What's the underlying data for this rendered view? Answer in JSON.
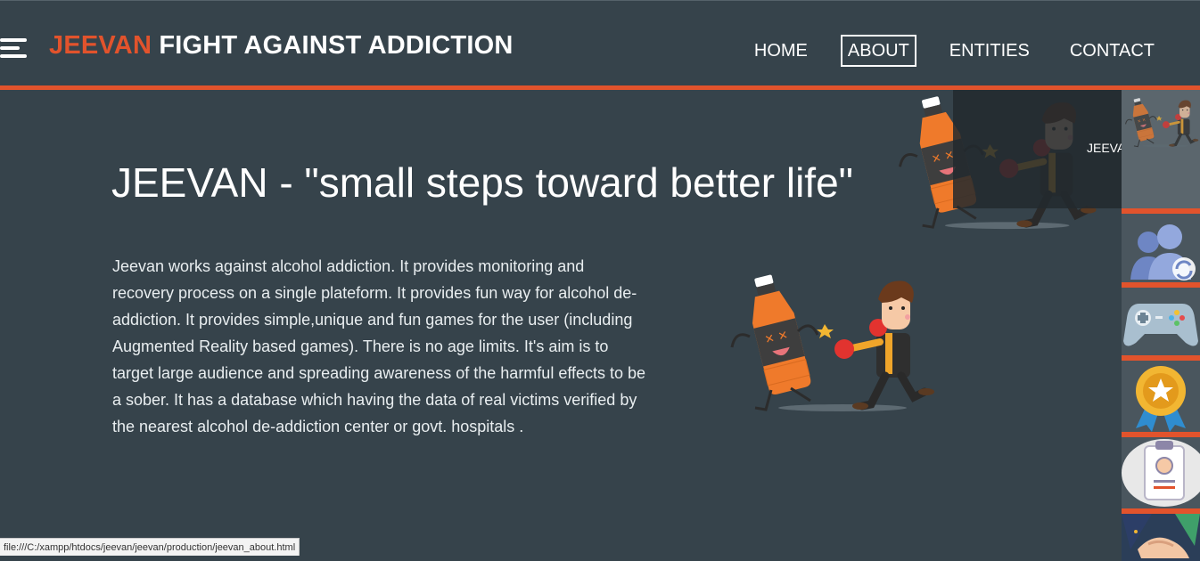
{
  "header": {
    "brand_accent": "JEEVAN",
    "brand_rest": " FIGHT AGAINST ADDICTION",
    "menu_icon": "hamburger-icon"
  },
  "nav": {
    "home": "HOME",
    "about": "ABOUT",
    "entities": "ENTITIES",
    "contact": "CONTACT",
    "active": "ABOUT"
  },
  "hero": {
    "title": "JEEVAN - \"small steps toward better life\"",
    "description": "Jeevan works against alcohol addiction. It provides monitoring and recovery process on a single plateform. It provides fun way for alcohol de-addiction. It provides simple,unique and fun games for the user (including Augmented Reality based games). There is no age limits. It's aim is to target large audience and spreading awareness of the harmful effects to be a sober. It has a database which having the data of real victims verified by the nearest alcohol de-addiction center or govt. hospitals ."
  },
  "sidebar": {
    "tooltip_label": "JEEVAN",
    "items": [
      {
        "icon": "jeevan-fight-icon"
      },
      {
        "icon": "users-sync-icon"
      },
      {
        "icon": "gamepad-icon"
      },
      {
        "icon": "award-badge-icon"
      },
      {
        "icon": "id-card-icon"
      },
      {
        "icon": "handshake-icon"
      }
    ]
  },
  "status_bar": {
    "url": "file:///C:/xampp/htdocs/jeevan/jeevan/production/jeevan_about.html"
  },
  "colors": {
    "background": "#36434b",
    "accent": "#e2532c"
  }
}
